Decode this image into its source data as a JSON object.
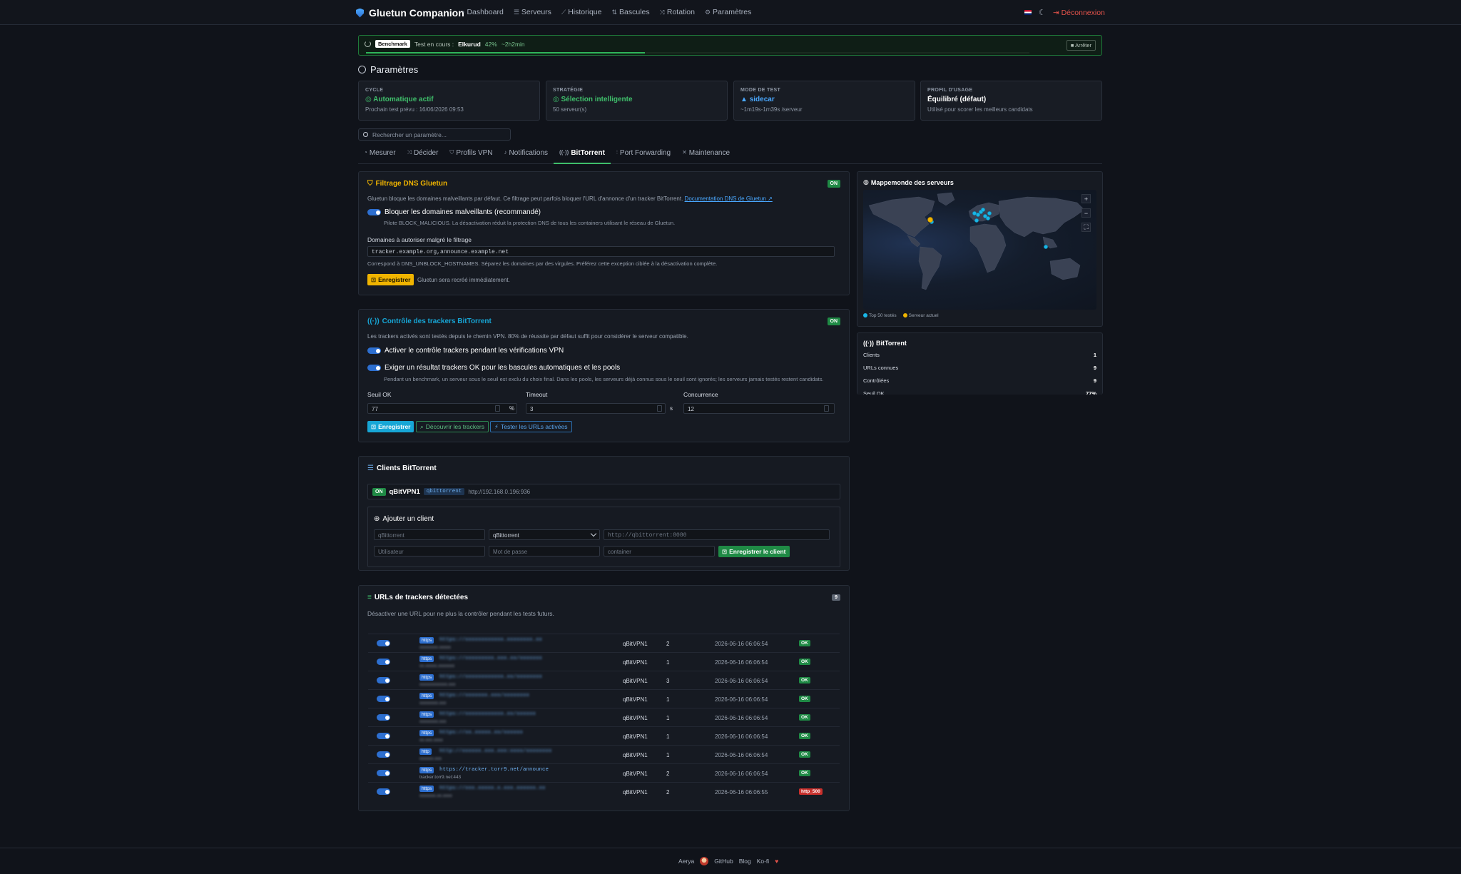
{
  "nav": {
    "brand": "Gluetun Companion",
    "links": [
      {
        "icon": "◔",
        "label": "Dashboard"
      },
      {
        "icon": "☰",
        "label": "Serveurs"
      },
      {
        "icon": "⟋",
        "label": "Historique"
      },
      {
        "icon": "⇅",
        "label": "Bascules"
      },
      {
        "icon": "⤨",
        "label": "Rotation"
      },
      {
        "icon": "⚙",
        "label": "Paramètres"
      }
    ],
    "logout": "Déconnexion"
  },
  "benchmark": {
    "badge": "Benchmark",
    "text": "Test en cours :",
    "server": "Elkurud",
    "pct": "42%",
    "eta": "~2h2min",
    "progress": 0.42,
    "stop": "Arrêter"
  },
  "page": {
    "title": "Paramètres"
  },
  "cards": [
    {
      "label": "CYCLE",
      "value": "Automatique actif",
      "sub": "Prochain test prévu : 16/06/2026 09:53"
    },
    {
      "label": "STRATÉGIE",
      "value": "Sélection intelligente",
      "sub": "50 serveur(s)"
    },
    {
      "label": "MODE DE TEST",
      "value": "sidecar",
      "sub": "~1m19s-1m39s /serveur"
    },
    {
      "label": "PROFIL D'USAGE",
      "value": "Équilibré (défaut)",
      "sub": "Utilisé pour scorer les meilleurs candidats"
    }
  ],
  "search": {
    "placeholder": "Rechercher un paramètre..."
  },
  "tabs": [
    "Mesurer",
    "Décider",
    "Profils VPN",
    "Notifications",
    "BitTorrent",
    "Port Forwarding",
    "Maintenance"
  ],
  "dns": {
    "title": "Filtrage DNS Gluetun",
    "on": "ON",
    "desc": "Gluetun bloque les domaines malveillants par défaut. Ce filtrage peut parfois bloquer l'URL d'annonce d'un tracker BitTorrent.",
    "doc_link": "Documentation DNS de Gluetun",
    "toggle_label": "Bloquer les domaines malveillants (recommandé)",
    "toggle_note": "Pilote BLOCK_MALICIOUS. La désactivation réduit la protection DNS de tous les containers utilisant le réseau de Gluetun.",
    "allow_label": "Domaines à autoriser malgré le filtrage",
    "allow_value": "tracker.example.org,announce.example.net",
    "allow_note": "Correspond à DNS_UNBLOCK_HOSTNAMES. Séparez les domaines par des virgules. Préférez cette exception ciblée à la désactivation complète.",
    "save": "Enregistrer",
    "save_note": "Gluetun sera recréé immédiatement."
  },
  "trackers": {
    "title": "Contrôle des trackers BitTorrent",
    "on": "ON",
    "desc": "Les trackers activés sont testés depuis le chemin VPN. 80% de réussite par défaut suffit pour considérer le serveur compatible.",
    "toggle1": "Activer le contrôle trackers pendant les vérifications VPN",
    "toggle2": "Exiger un résultat trackers OK pour les bascules automatiques et les pools",
    "toggle2_note": "Pendant un benchmark, un serveur sous le seuil est exclu du choix final. Dans les pools, les serveurs déjà connus sous le seuil sont ignorés; les serveurs jamais testés restent candidats.",
    "threshold_label": "Seuil OK",
    "threshold_value": "77",
    "threshold_unit": "%",
    "timeout_label": "Timeout",
    "timeout_value": "3",
    "timeout_unit": "s",
    "concurrency_label": "Concurrence",
    "concurrency_value": "12",
    "save": "Enregistrer",
    "discover": "Découvrir les trackers",
    "test": "Tester les URLs activées"
  },
  "clients": {
    "title": "Clients BitTorrent",
    "row": {
      "status": "ON",
      "name": "qBitVPN1",
      "type": "qbittorrent",
      "url": "http://192.168.0.196:936"
    },
    "add_title": "Ajouter un client",
    "name_ph": "qBittorrent",
    "type_value": "qBittorrent",
    "url_ph": "http://qbittorrent:8080",
    "user_ph": "Utilisateur",
    "pass_ph": "Mot de passe",
    "container_ph": "container",
    "save": "Enregistrer le client"
  },
  "urls": {
    "title": "URLs de trackers détectées",
    "count": "9",
    "desc": "Désactiver une URL pour ne plus la contrôler pendant les tests futurs.",
    "rows": [
      {
        "tls": "https",
        "url": "https://xxxxxxxxxxxx.xxxxxxxx.xx",
        "host": "xxxxxxxx.xxxxx",
        "client": "qBitVPN1",
        "count": "2",
        "date": "2026-06-16 06:06:54",
        "status": "OK",
        "blur": true
      },
      {
        "tls": "https",
        "url": "https://xxxxxxxxx.xxx.xx/xxxxxxx",
        "host": "xx.xxxxx.xxxxxxx",
        "client": "qBitVPN1",
        "count": "1",
        "date": "2026-06-16 06:06:54",
        "status": "OK",
        "blur": true
      },
      {
        "tls": "https",
        "url": "https://xxxxxxxxxxxx.xx/xxxxxxxx",
        "host": "xxxxxxxxxxxx.xxx",
        "client": "qBitVPN1",
        "count": "3",
        "date": "2026-06-16 06:06:54",
        "status": "OK",
        "blur": true
      },
      {
        "tls": "https",
        "url": "https://xxxxxxx.xxx/xxxxxxxx",
        "host": "xxxxxxxx.xxx",
        "client": "qBitVPN1",
        "count": "1",
        "date": "2026-06-16 06:06:54",
        "status": "OK",
        "blur": true
      },
      {
        "tls": "https",
        "url": "https://xxxxxxxxxxxx.xx/xxxxxx",
        "host": "xxxxxxxx.xxx",
        "client": "qBitVPN1",
        "count": "1",
        "date": "2026-06-16 06:06:54",
        "status": "OK",
        "blur": true
      },
      {
        "tls": "https",
        "url": "https://xx.xxxxx.xx/xxxxxx",
        "host": "xx.xxx.xxxx",
        "client": "qBitVPN1",
        "count": "1",
        "date": "2026-06-16 06:06:54",
        "status": "OK",
        "blur": true
      },
      {
        "tls": "http",
        "url": "http://xxxxxx.xxx.xxx:xxxx/xxxxxxxx",
        "host": "xxxxxx.xxx",
        "client": "qBitVPN1",
        "count": "1",
        "date": "2026-06-16 06:06:54",
        "status": "OK",
        "blur": true
      },
      {
        "tls": "https",
        "url": "https://tracker.torr9.net/announce",
        "host": "tracker.torr9.net:443",
        "client": "qBitVPN1",
        "count": "2",
        "date": "2026-06-16 06:06:54",
        "status": "OK",
        "blur": false
      },
      {
        "tls": "https",
        "url": "https://xxx.xxxxx.x.xxx.xxxxxx.xx",
        "host": "xxxxxxx.xx.xxxx",
        "client": "qBitVPN1",
        "count": "2",
        "date": "2026-06-16 06:06:55",
        "status": "http_500",
        "blur": true
      }
    ]
  },
  "map": {
    "title": "Mappemonde des serveurs",
    "legend_top": "Top 50 testés",
    "legend_current": "Serveur actuel",
    "zoom_in": "+",
    "zoom_out": "−",
    "fullscreen": "⛶"
  },
  "bt_side": {
    "title": "BitTorrent",
    "rows": [
      {
        "label": "Clients",
        "value": "1"
      },
      {
        "label": "URLs connues",
        "value": "9"
      },
      {
        "label": "Contrôlées",
        "value": "9"
      },
      {
        "label": "Seuil OK",
        "value": "77%"
      }
    ]
  },
  "footer": {
    "author": "Aerya",
    "links": [
      "GitHub",
      "Blog",
      "Ko-fi"
    ],
    "heart": "♥"
  }
}
